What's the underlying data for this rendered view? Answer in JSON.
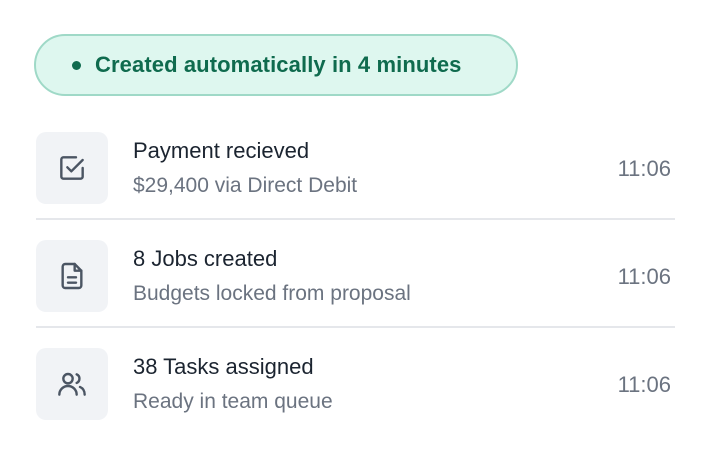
{
  "status": {
    "label": "Created automatically in 4 minutes",
    "color": "#0f6b4e",
    "background": "#def7ef"
  },
  "activity": [
    {
      "icon": "checkbox-check-icon",
      "title": "Payment recieved",
      "subtitle": "$29,400 via Direct Debit",
      "time": "11:06"
    },
    {
      "icon": "document-icon",
      "title": "8 Jobs created",
      "subtitle": "Budgets locked from proposal",
      "time": "11:06"
    },
    {
      "icon": "users-icon",
      "title": "38 Tasks assigned",
      "subtitle": "Ready in team queue",
      "time": "11:06"
    }
  ]
}
